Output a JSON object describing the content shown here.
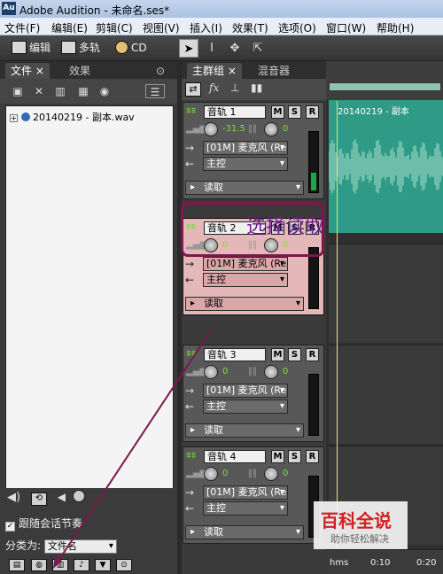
{
  "titlebar": {
    "app_icon": "Au",
    "title": "Adobe Audition - 未命名.ses*"
  },
  "menu": [
    "文件(F)",
    "编辑(E)",
    "剪辑(C)",
    "视图(V)",
    "插入(I)",
    "效果(T)",
    "选项(O)",
    "窗口(W)",
    "帮助(H)"
  ],
  "toolbar": {
    "edit": "编辑",
    "multitrack": "多轨",
    "cd": "CD"
  },
  "left_panel": {
    "tabs": [
      "文件",
      "效果"
    ],
    "files": [
      {
        "name": "20140219 - 副本.wav"
      }
    ],
    "follow_session_tempo": "跟随会话节奏",
    "sort_label": "分类为:",
    "sort_value": "文件名"
  },
  "track_panel": {
    "tabs": [
      "主群组",
      "混音器"
    ]
  },
  "tracks": [
    {
      "name": "音轨 1",
      "volume": "-31.5",
      "pan": "0",
      "input": "[01M] 麦克风 (Re",
      "output": "主控",
      "automation": "读取",
      "meter_level": 0.3,
      "selected": false
    },
    {
      "name": "音轨 2",
      "volume": "0",
      "pan": "0",
      "input": "[01M] 麦克风 (Re",
      "output": "主控",
      "automation": "读取",
      "meter_level": 0.0,
      "selected": true
    },
    {
      "name": "音轨 3",
      "volume": "0",
      "pan": "0",
      "input": "[01M] 麦克风 (Re",
      "output": "主控",
      "automation": "读取",
      "meter_level": 0.0,
      "selected": false
    },
    {
      "name": "音轨 4",
      "volume": "0",
      "pan": "0",
      "input": "[01M] 麦克风 (Re",
      "output": "主控",
      "automation": "读取",
      "meter_level": 0.0,
      "selected": false
    }
  ],
  "track_buttons": {
    "mute": "M",
    "solo": "S",
    "record": "R"
  },
  "timeline": {
    "clip_title": "20140219 - 副本",
    "ruler": [
      "hms",
      "0:10",
      "0:20"
    ]
  },
  "annotation": {
    "text": "选择读取",
    "color": "#7e164f"
  },
  "watermark": {
    "main": "百科全说",
    "sub": "助你轻松解决"
  },
  "colors": {
    "clip": "#2f9a85",
    "selected_track": "#e4b8b8",
    "value_green": "#7fdc3a"
  }
}
